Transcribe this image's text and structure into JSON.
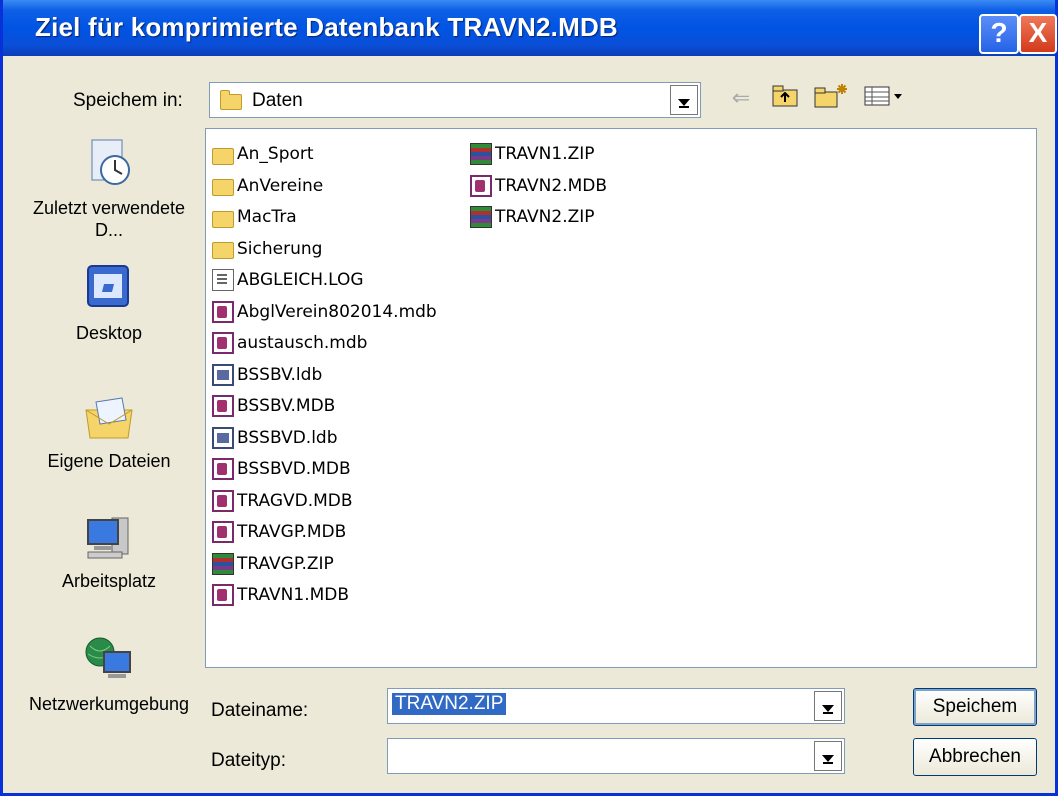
{
  "window": {
    "title": "Ziel für komprimierte Datenbank TRAVN2.MDB",
    "help_glyph": "?",
    "close_glyph": "X"
  },
  "save_in": {
    "label": "Speichem in:",
    "value": "Daten"
  },
  "toolbar": {
    "back_glyph": "⇐",
    "up_glyph": "⤴",
    "new_folder_glyph": "✱",
    "view_glyph": "▦▾"
  },
  "places": [
    {
      "label": "Zuletzt verwendete D...",
      "icon": "recent-docs-icon"
    },
    {
      "label": "Desktop",
      "icon": "desktop-icon"
    },
    {
      "label": "Eigene Dateien",
      "icon": "my-documents-icon"
    },
    {
      "label": "Arbeitsplatz",
      "icon": "my-computer-icon"
    },
    {
      "label": "Netzwerkumgebung",
      "icon": "network-places-icon"
    }
  ],
  "files_col1": [
    {
      "name": "An_Sport",
      "type": "folder"
    },
    {
      "name": "AnVereine",
      "type": "folder"
    },
    {
      "name": "MacTra",
      "type": "folder"
    },
    {
      "name": "Sicherung",
      "type": "folder"
    },
    {
      "name": "ABGLEICH.LOG",
      "type": "log"
    },
    {
      "name": "AbglVerein802014.mdb",
      "type": "mdb"
    },
    {
      "name": "austausch.mdb",
      "type": "mdb"
    },
    {
      "name": "BSSBV.ldb",
      "type": "ldb"
    },
    {
      "name": "BSSBV.MDB",
      "type": "mdb"
    },
    {
      "name": "BSSBVD.ldb",
      "type": "ldb"
    },
    {
      "name": "BSSBVD.MDB",
      "type": "mdb"
    },
    {
      "name": "TRAGVD.MDB",
      "type": "mdb"
    },
    {
      "name": "TRAVGP.MDB",
      "type": "mdb"
    },
    {
      "name": "TRAVGP.ZIP",
      "type": "zip"
    },
    {
      "name": "TRAVN1.MDB",
      "type": "mdb"
    }
  ],
  "files_col2": [
    {
      "name": "TRAVN1.ZIP",
      "type": "zip"
    },
    {
      "name": "TRAVN2.MDB",
      "type": "mdb"
    },
    {
      "name": "TRAVN2.ZIP",
      "type": "zip"
    }
  ],
  "filename": {
    "label": "Dateiname:",
    "value": "TRAVN2.ZIP"
  },
  "filetype": {
    "label": "Dateityp:",
    "value": ""
  },
  "buttons": {
    "save": "Speichem",
    "cancel": "Abbrechen"
  }
}
